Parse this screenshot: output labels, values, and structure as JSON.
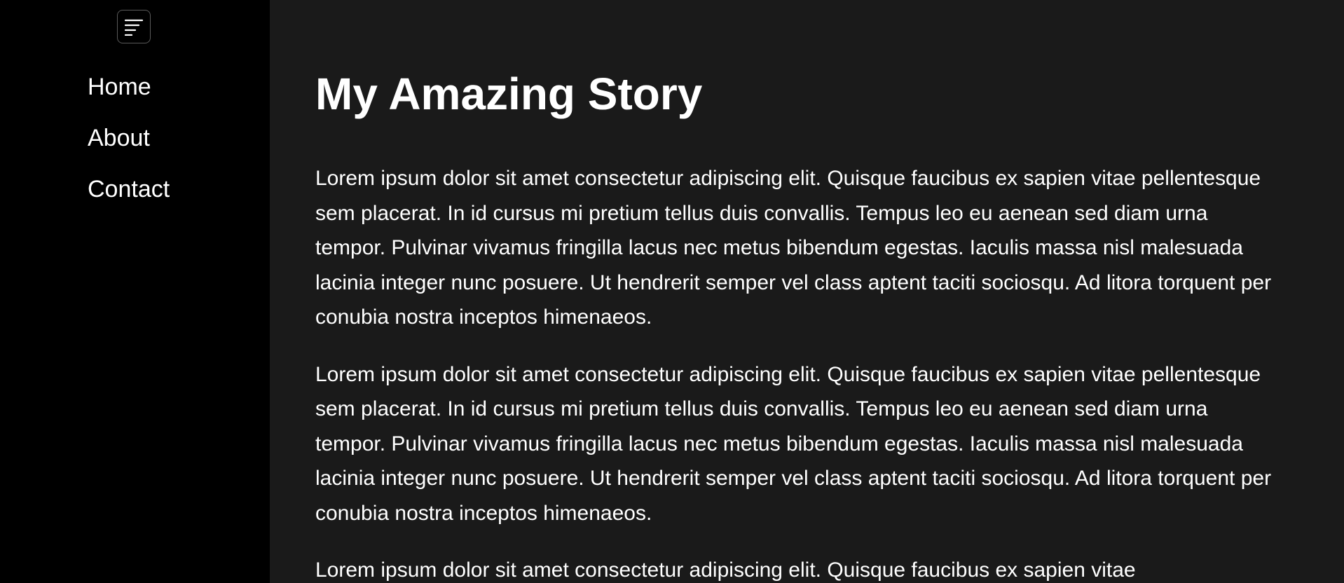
{
  "sidebar": {
    "menu_icon": "menu-lines-icon",
    "nav": [
      {
        "label": "Home"
      },
      {
        "label": "About"
      },
      {
        "label": "Contact"
      }
    ]
  },
  "main": {
    "title": "My Amazing Story",
    "paragraphs": [
      "Lorem ipsum dolor sit amet consectetur adipiscing elit. Quisque faucibus ex sapien vitae pellentesque sem placerat. In id cursus mi pretium tellus duis convallis. Tempus leo eu aenean sed diam urna tempor. Pulvinar vivamus fringilla lacus nec metus bibendum egestas. Iaculis massa nisl malesuada lacinia integer nunc posuere. Ut hendrerit semper vel class aptent taciti sociosqu. Ad litora torquent per conubia nostra inceptos himenaeos.",
      "Lorem ipsum dolor sit amet consectetur adipiscing elit. Quisque faucibus ex sapien vitae pellentesque sem placerat. In id cursus mi pretium tellus duis convallis. Tempus leo eu aenean sed diam urna tempor. Pulvinar vivamus fringilla lacus nec metus bibendum egestas. Iaculis massa nisl malesuada lacinia integer nunc posuere. Ut hendrerit semper vel class aptent taciti sociosqu. Ad litora torquent per conubia nostra inceptos himenaeos.",
      "Lorem ipsum dolor sit amet consectetur adipiscing elit. Quisque faucibus ex sapien vitae"
    ]
  },
  "colors": {
    "sidebar_bg": "#000000",
    "main_bg": "#1a1a1a",
    "text": "#ffffff",
    "toggle_border": "#5a5a5a"
  }
}
